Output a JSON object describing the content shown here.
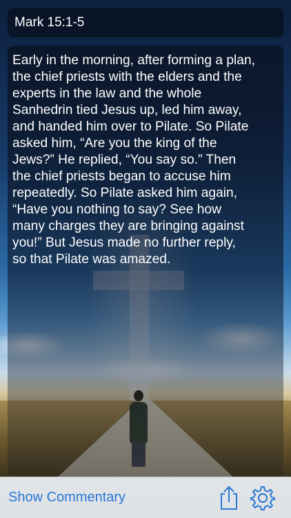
{
  "header": {
    "reference": "Mark 15:1-5"
  },
  "passage": {
    "text": "Early in the morning, after forming a plan,\nthe chief priests with the elders and the\nexperts in the law and the whole\nSanhedrin tied Jesus up, led him away,\nand handed him over to Pilate.  So Pilate\nasked him, “Are you the king of the\nJews?” He replied, “You say so.”  Then\nthe chief priests began to accuse him\nrepeatedly.  So Pilate asked him again,\n“Have you nothing to say? See how\nmany charges they are bringing against\nyou!”  But Jesus made no further reply,\nso that Pilate was amazed."
  },
  "toolbar": {
    "commentary_label": "Show Commentary",
    "share_icon": "share-icon",
    "settings_icon": "gear-icon"
  },
  "colors": {
    "accent": "#2a78d6",
    "toolbar_bg": "#e8ecf0",
    "panel_bg": "#0a1222"
  }
}
